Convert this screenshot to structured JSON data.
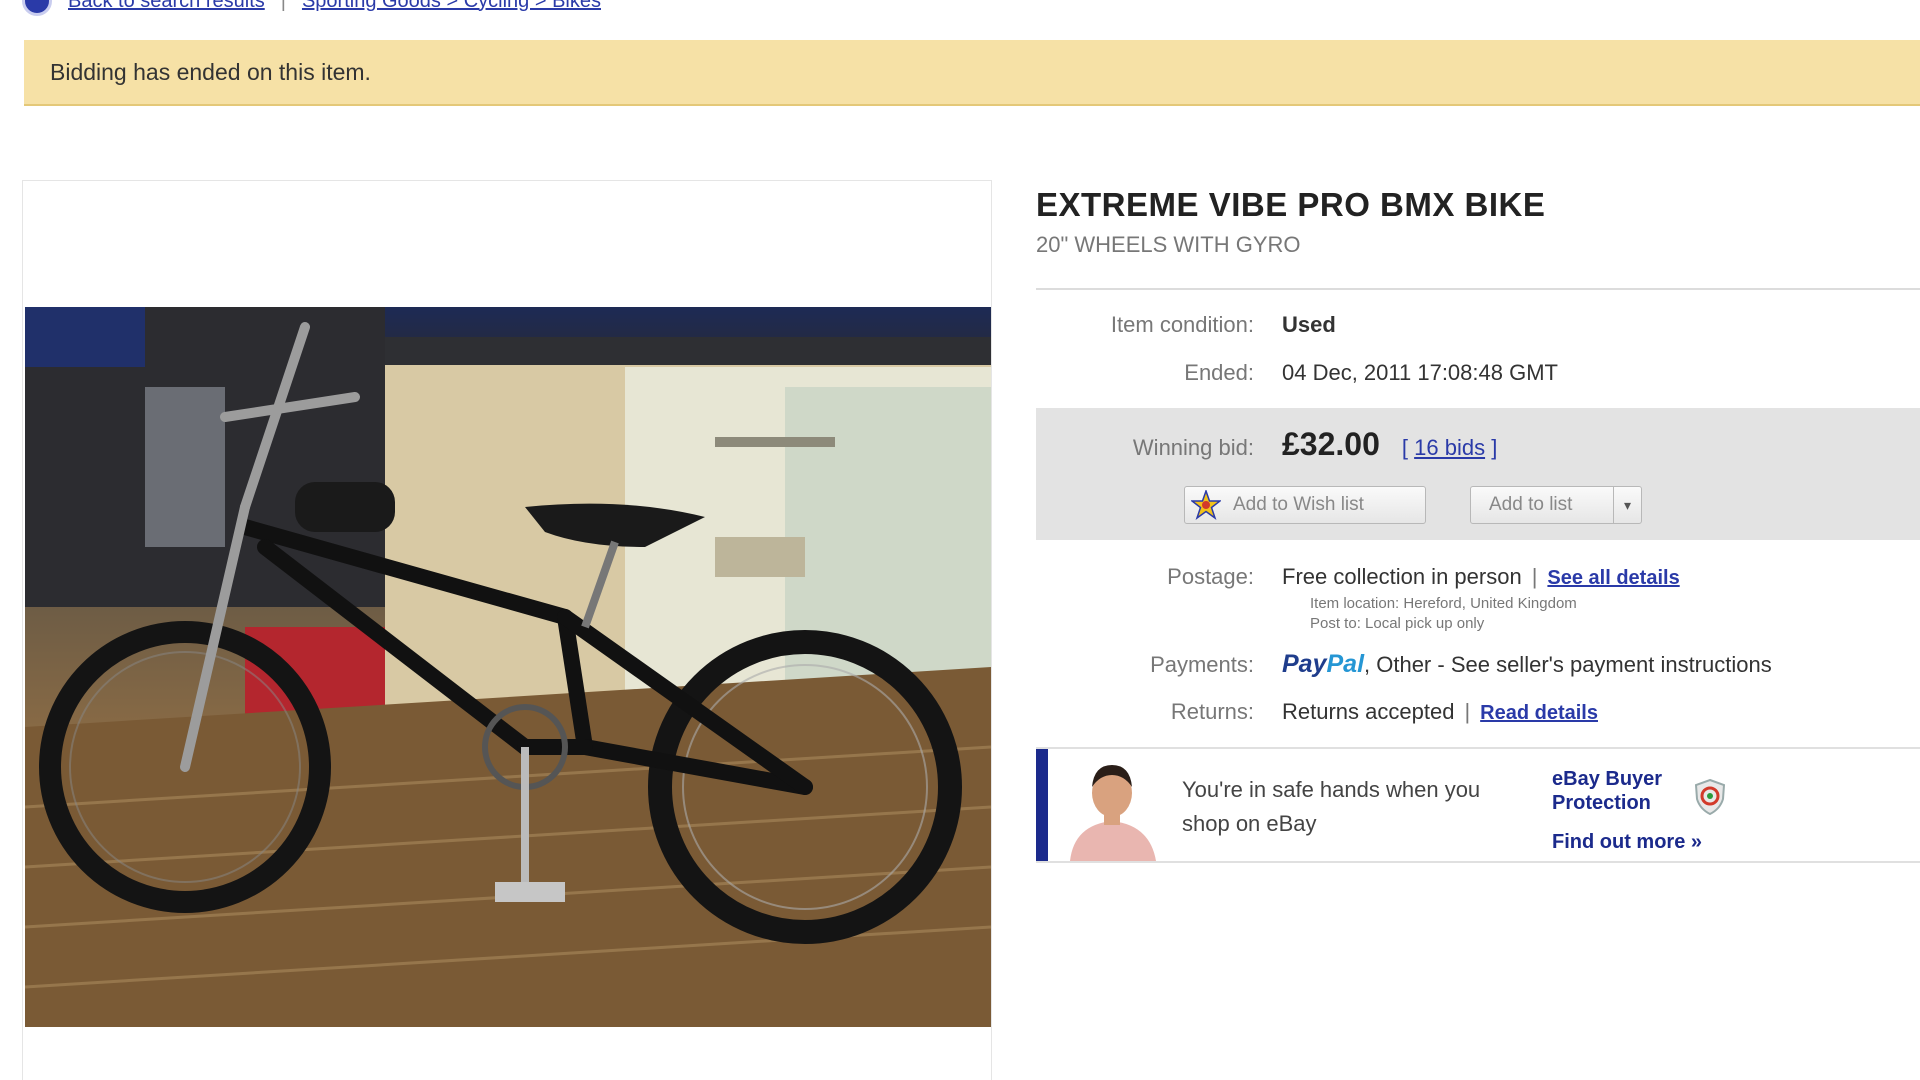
{
  "topnav": {
    "back_link": "Back to search results",
    "breadcrumb": "Sporting Goods > Cycling > Bikes"
  },
  "banner": {
    "text": "Bidding has ended on this item."
  },
  "item": {
    "title": "EXTREME VIBE PRO BMX BIKE",
    "subtitle": "20\" WHEELS WITH GYRO"
  },
  "condition": {
    "label": "Item condition:",
    "value": "Used"
  },
  "ended": {
    "label": "Ended:",
    "value": "04 Dec, 2011 17:08:48 GMT"
  },
  "bid": {
    "label": "Winning bid:",
    "price": "£32.00",
    "bids_open": "[",
    "bids_link": "16 bids",
    "bids_close": "]",
    "wishlist_button": "Add to Wish list",
    "list_button": "Add to list",
    "list_caret": "▾"
  },
  "postage": {
    "label": "Postage:",
    "value": "Free collection in person",
    "link": "See all details",
    "location": "Item location: Hereford, United Kingdom",
    "post_to": "Post to: Local pick up only"
  },
  "payments": {
    "label": "Payments:",
    "paypal_a": "Pay",
    "paypal_b": "Pal",
    "value": ", Other - See seller's payment instructions"
  },
  "returns": {
    "label": "Returns:",
    "value": "Returns accepted",
    "link": "Read details"
  },
  "protection": {
    "text": "You're in safe hands when you shop on eBay",
    "brand": "eBay Buyer Protection",
    "find_more": "Find out more »"
  },
  "colors": {
    "banner_bg": "#f6e1a6",
    "link_blue": "#2a3aa8",
    "protection_bar": "#1b2a8c",
    "bidbox_bg": "#e3e3e3"
  }
}
